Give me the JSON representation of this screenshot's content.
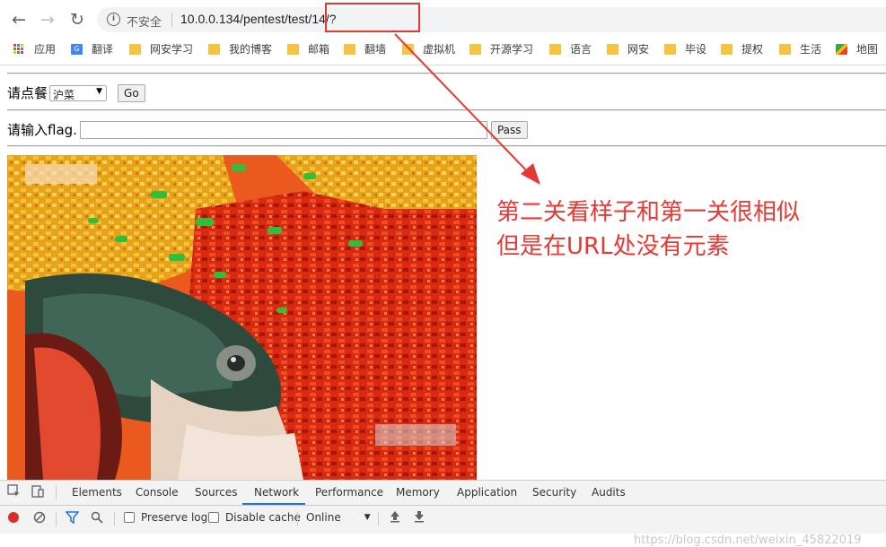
{
  "browser": {
    "security_label": "不安全",
    "url": "10.0.0.134/pentest/test/14/?",
    "bookmarks": [
      "应用",
      "翻译",
      "网安学习",
      "我的博客",
      "邮箱",
      "翻墙",
      "虚拟机",
      "开源学习",
      "语言",
      "网安",
      "毕设",
      "提权",
      "生活",
      "地图"
    ]
  },
  "page": {
    "order_label": "请点餐",
    "order_select_value": "沪菜",
    "go_button": "Go",
    "flag_label": "请输入flag.",
    "flag_value": "",
    "pass_button": "Pass"
  },
  "annotation": {
    "line1": "第二关看样子和第一关很相似",
    "line2": "但是在URL处没有元素",
    "color": "#e53935"
  },
  "devtools": {
    "tabs": [
      "Elements",
      "Console",
      "Sources",
      "Network",
      "Performance",
      "Memory",
      "Application",
      "Security",
      "Audits"
    ],
    "active_tab": "Network",
    "preserve_log": "Preserve log",
    "disable_cache": "Disable cache",
    "throttle": "Online",
    "watermark": "https://blog.csdn.net/weixin_45822019"
  }
}
